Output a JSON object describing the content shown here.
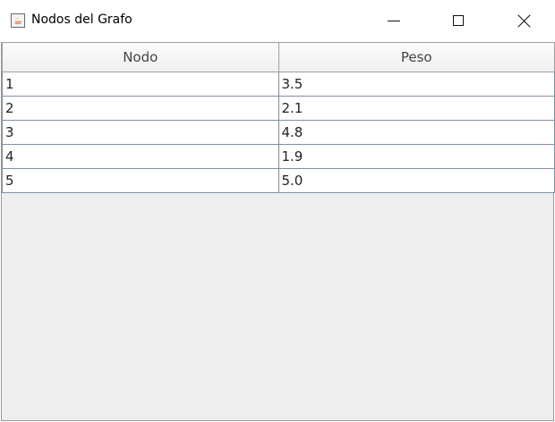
{
  "window": {
    "title": "Nodos del Grafo",
    "app_icon": "java-cup-icon",
    "controls": {
      "minimize_icon": "minimize-icon",
      "maximize_icon": "maximize-icon",
      "close_icon": "close-icon"
    }
  },
  "table": {
    "headers": [
      "Nodo",
      "Peso"
    ],
    "rows": [
      [
        "1",
        "3.5"
      ],
      [
        "2",
        "2.1"
      ],
      [
        "3",
        "4.8"
      ],
      [
        "4",
        "1.9"
      ],
      [
        "5",
        "5.0"
      ]
    ]
  }
}
